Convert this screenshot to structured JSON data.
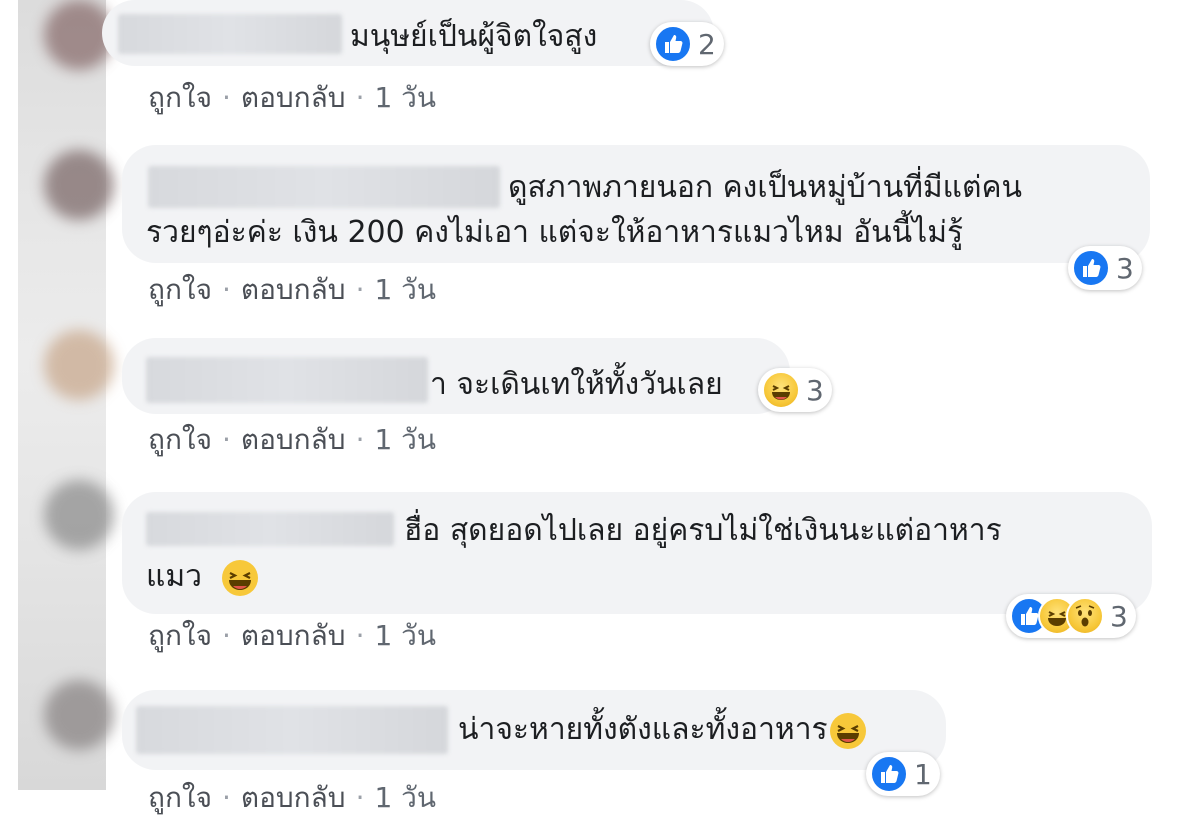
{
  "comments": [
    {
      "text_lines": [
        "มนุษย์เป็นผู้จิตใจสูง"
      ],
      "reactions": {
        "icons": [
          "like-icon"
        ],
        "count": "2"
      },
      "actions": {
        "like": "ถูกใจ",
        "reply": "ตอบกลับ",
        "time": "1 วัน"
      }
    },
    {
      "text_lines": [
        "ดูสภาพภายนอก คงเป็นหมู่บ้านที่มีแต่คน",
        "รวยๆอ่ะค่ะ เงิน 200 คงไม่เอา แต่จะให้อาหารแมวไหม อันนี้ไม่รู้"
      ],
      "reactions": {
        "icons": [
          "like-icon"
        ],
        "count": "3"
      },
      "actions": {
        "like": "ถูกใจ",
        "reply": "ตอบกลับ",
        "time": "1 วัน"
      }
    },
    {
      "text_lines": [
        "า จะเดินเทให้ทั้งวันเลย"
      ],
      "reactions": {
        "icons": [
          "haha-icon"
        ],
        "count": "3"
      },
      "actions": {
        "like": "ถูกใจ",
        "reply": "ตอบกลับ",
        "time": "1 วัน"
      }
    },
    {
      "text_lines": [
        "ฮื่อ สุดยอดไปเลย อยู่ครบไม่ใช่เงินนะแต่อาหาร",
        "แมว"
      ],
      "inline_emoji": "haha-emoji",
      "reactions": {
        "icons": [
          "like-icon",
          "haha-icon",
          "wow-icon"
        ],
        "count": "3"
      },
      "actions": {
        "like": "ถูกใจ",
        "reply": "ตอบกลับ",
        "time": "1 วัน"
      }
    },
    {
      "text_lines": [
        "น่าจะหายทั้งตังและทั้งอาหาร"
      ],
      "inline_emoji": "haha-emoji",
      "reactions": {
        "icons": [
          "like-icon"
        ],
        "count": "1"
      },
      "actions": {
        "like": "ถูกใจ",
        "reply": "ตอบกลับ",
        "time": "1 วัน"
      }
    }
  ],
  "colors": {
    "bubble": "#f2f3f5",
    "link": "#4b4f56",
    "like_blue": "#1877f2",
    "haha_yellow": "#f7c83a"
  }
}
